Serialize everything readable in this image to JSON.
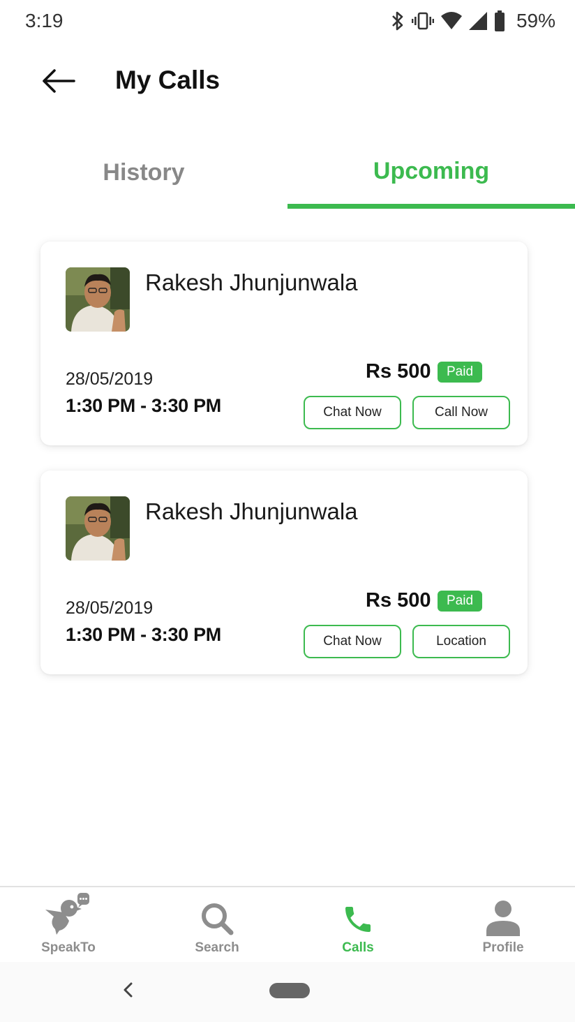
{
  "status_bar": {
    "time": "3:19",
    "battery_percent": "59%",
    "icons": [
      "bluetooth-icon",
      "vibrate-icon",
      "wifi-icon",
      "cell-signal-icon",
      "battery-icon"
    ]
  },
  "header": {
    "title": "My Calls",
    "back_icon": "arrow-left-icon"
  },
  "tabs": {
    "items": [
      {
        "label": "History",
        "active": false
      },
      {
        "label": "Upcoming",
        "active": true
      }
    ]
  },
  "colors": {
    "accent": "#3cba4f",
    "inactive_text": "#888888"
  },
  "calls": [
    {
      "name": "Rakesh Jhunjunwala",
      "date": "28/05/2019",
      "time": "1:30 PM - 3:30 PM",
      "price": "Rs 500",
      "status": "Paid",
      "actions": [
        "Chat Now",
        "Call Now"
      ]
    },
    {
      "name": "Rakesh Jhunjunwala",
      "date": "28/05/2019",
      "time": "1:30 PM - 3:30 PM",
      "price": "Rs 500",
      "status": "Paid",
      "actions": [
        "Chat Now",
        "Location"
      ]
    }
  ],
  "bottom_nav": {
    "items": [
      {
        "label": "SpeakTo",
        "icon": "bird-speech-icon",
        "active": false
      },
      {
        "label": "Search",
        "icon": "search-icon",
        "active": false
      },
      {
        "label": "Calls",
        "icon": "phone-icon",
        "active": true
      },
      {
        "label": "Profile",
        "icon": "person-icon",
        "active": false
      }
    ]
  }
}
